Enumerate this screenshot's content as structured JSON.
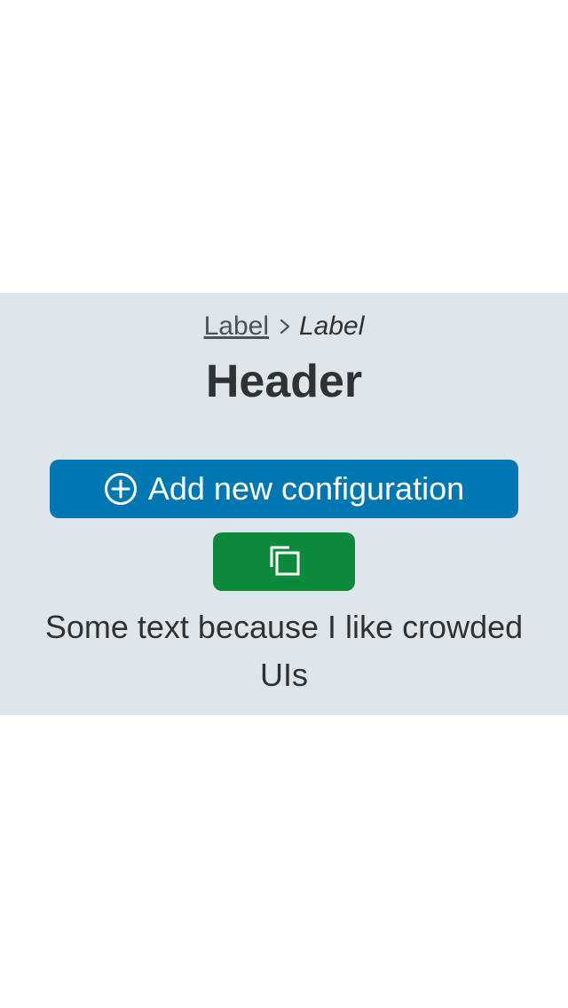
{
  "breadcrumb": {
    "link_label": "Label",
    "current_label": "Label",
    "separator_icon": "chevron-right-icon"
  },
  "header": {
    "title": "Header"
  },
  "actions": {
    "add_label": "Add new configuration",
    "add_icon": "plus-circle-icon",
    "add_color": "#0077b0",
    "copy_icon": "copy-icon",
    "copy_color": "#0c893a"
  },
  "content": {
    "text": "Some text because I like crowded UIs"
  },
  "colors": {
    "panel_background": "#dfe6eb",
    "text": "#2e3236"
  }
}
